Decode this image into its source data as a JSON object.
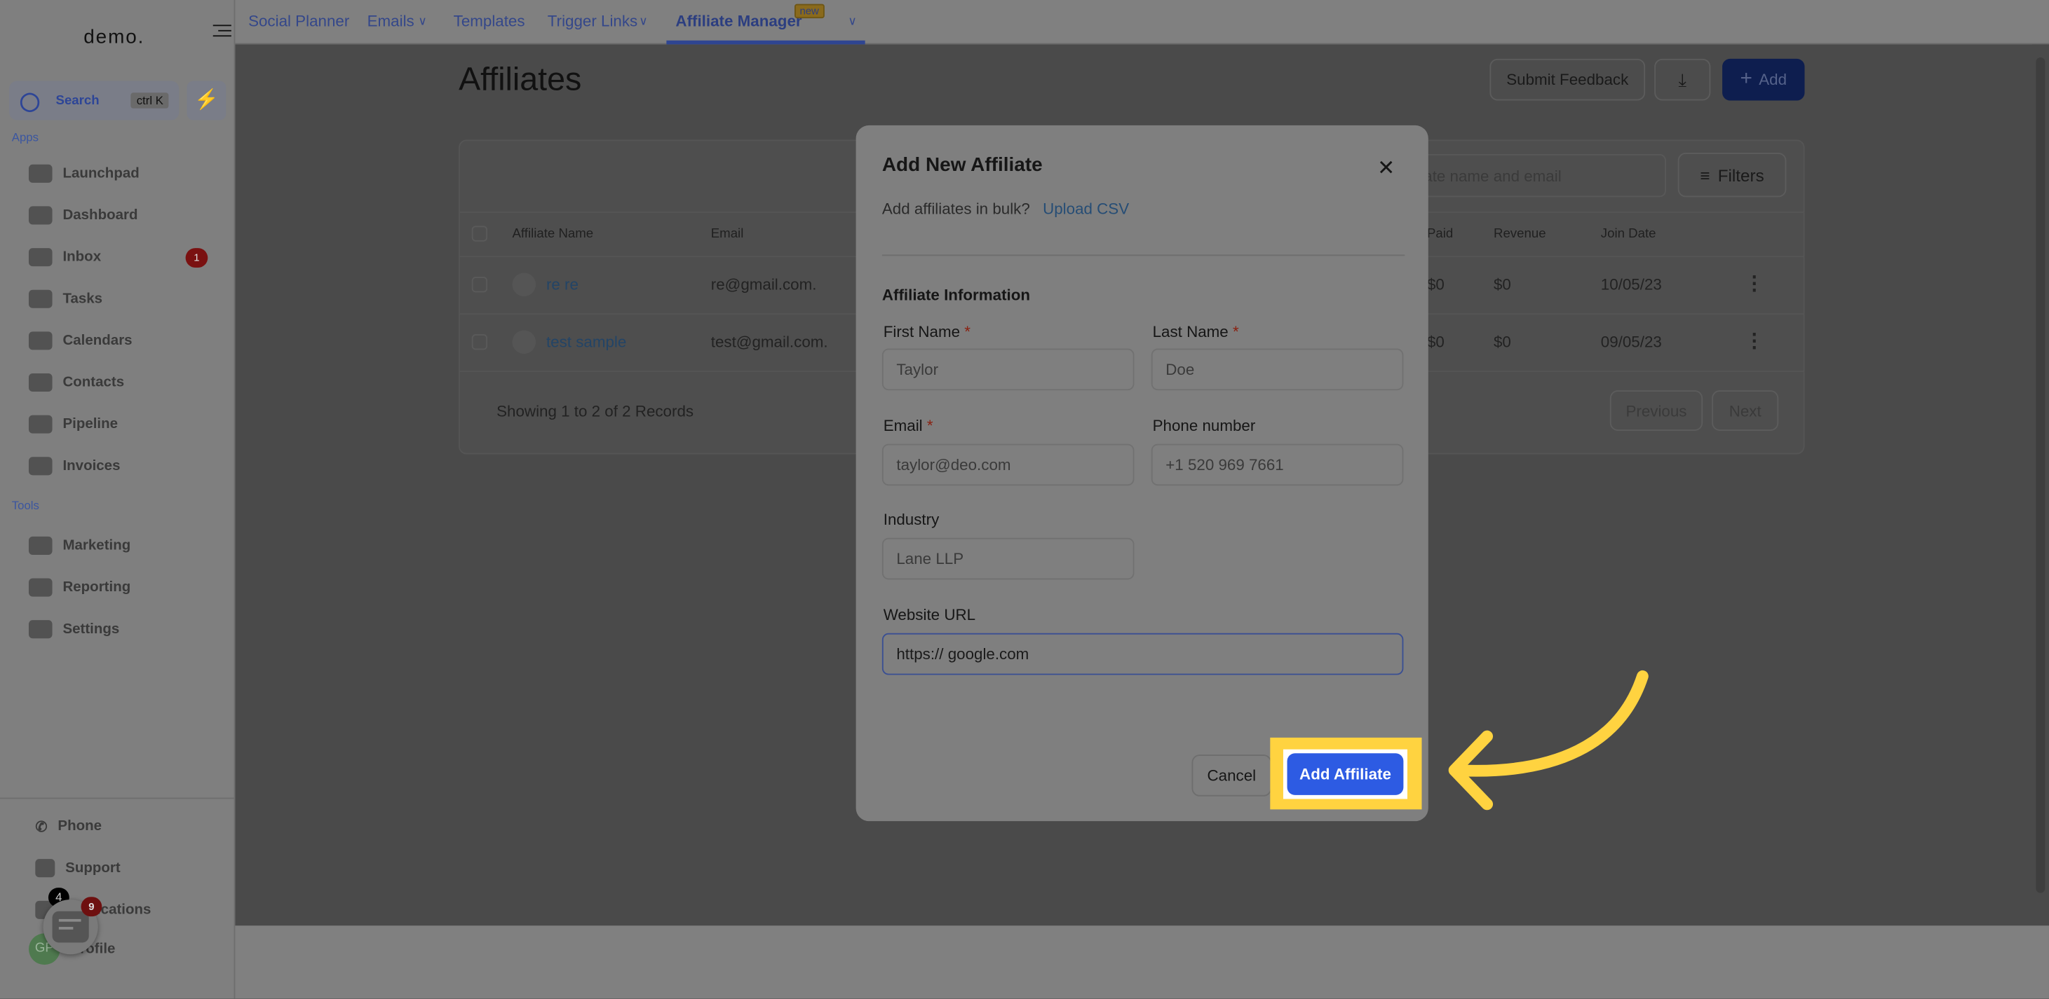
{
  "sidebar": {
    "logo": "demo.",
    "search_label": "Search",
    "search_shortcut": "ctrl K",
    "apps_heading": "Apps",
    "apps": [
      {
        "label": "Launchpad",
        "icon": "rocket-icon"
      },
      {
        "label": "Dashboard",
        "icon": "dashboard-icon"
      },
      {
        "label": "Inbox",
        "icon": "inbox-icon",
        "badge": "1"
      },
      {
        "label": "Tasks",
        "icon": "clipboard-icon"
      },
      {
        "label": "Calendars",
        "icon": "calendar-icon"
      },
      {
        "label": "Contacts",
        "icon": "person-icon"
      },
      {
        "label": "Pipeline",
        "icon": "funnel-icon"
      },
      {
        "label": "Invoices",
        "icon": "invoice-icon"
      }
    ],
    "tools_heading": "Tools",
    "tools": [
      {
        "label": "Marketing",
        "icon": "megaphone-icon"
      },
      {
        "label": "Reporting",
        "icon": "pie-chart-icon"
      },
      {
        "label": "Settings",
        "icon": "gear-icon"
      }
    ],
    "bottom": [
      {
        "label": "Phone",
        "icon": "phone-icon"
      },
      {
        "label": "Support",
        "icon": "chat-icon"
      },
      {
        "label": "Notifications",
        "icon": "bell-icon",
        "badge": "4"
      },
      {
        "label": "Profile",
        "avatar": "GP"
      }
    ],
    "chat_widget_badge": "9"
  },
  "topnav": {
    "tabs": [
      {
        "label": "Social Planner"
      },
      {
        "label": "Emails",
        "dropdown": true
      },
      {
        "label": "Templates"
      },
      {
        "label": "Trigger Links",
        "dropdown": true
      },
      {
        "label": "Affiliate Manager",
        "active": true,
        "badge": "new"
      }
    ]
  },
  "page": {
    "title": "Affiliates",
    "submit_feedback": "Submit Feedback",
    "add_label": "Add",
    "search_placeholder": "Search by affiliate name and email",
    "filters_label": "Filters",
    "columns": [
      "Affiliate Name",
      "Email",
      "Paid",
      "Revenue",
      "Join Date"
    ],
    "rows": [
      {
        "name": "re re",
        "email": "re@gmail.com.",
        "paid": "$0",
        "revenue": "$0",
        "join_date": "10/05/23"
      },
      {
        "name": "test sample",
        "email": "test@gmail.com.",
        "paid": "$0",
        "revenue": "$0",
        "join_date": "09/05/23"
      }
    ],
    "showing": "Showing 1 to 2 of 2 Records",
    "previous": "Previous",
    "next": "Next"
  },
  "modal": {
    "title": "Add New Affiliate",
    "bulk_text": "Add affiliates in bulk?",
    "upload_csv": "Upload CSV",
    "section": "Affiliate Information",
    "first_name_label": "First Name",
    "first_name_placeholder": "Taylor",
    "last_name_label": "Last Name",
    "last_name_placeholder": "Doe",
    "email_label": "Email",
    "email_placeholder": "taylor@deo.com",
    "phone_label": "Phone number",
    "phone_placeholder": "+1 520 969 7661",
    "industry_label": "Industry",
    "industry_placeholder": "Lane LLP",
    "website_label": "Website URL",
    "website_value": "https:// google.com",
    "required_mark": "*",
    "cancel": "Cancel",
    "submit": "Add Affiliate"
  },
  "colors": {
    "primary": "#2d5be3",
    "highlight": "#ffd340",
    "overlay": "#4a4a4a"
  }
}
